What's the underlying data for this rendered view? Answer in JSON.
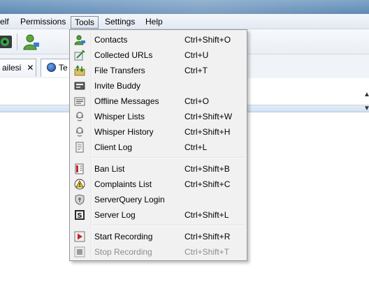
{
  "menubar": {
    "items": [
      {
        "label": "elf"
      },
      {
        "label": "Permissions"
      },
      {
        "label": "Tools"
      },
      {
        "label": "Settings"
      },
      {
        "label": "Help"
      }
    ]
  },
  "tabs": [
    {
      "label": "ailesi",
      "close": "✕"
    },
    {
      "label": "Te"
    }
  ],
  "tools_menu": {
    "groups": [
      [
        {
          "label": "Contacts",
          "shortcut": "Ctrl+Shift+O",
          "icon": "contacts-icon"
        },
        {
          "label": "Collected URLs",
          "shortcut": "Ctrl+U",
          "icon": "collected-urls-icon"
        },
        {
          "label": "File Transfers",
          "shortcut": "Ctrl+T",
          "icon": "file-transfers-icon"
        },
        {
          "label": "Invite Buddy",
          "shortcut": "",
          "icon": "invite-buddy-icon"
        },
        {
          "label": "Offline Messages",
          "shortcut": "Ctrl+O",
          "icon": "offline-messages-icon"
        },
        {
          "label": "Whisper Lists",
          "shortcut": "Ctrl+Shift+W",
          "icon": "whisper-lists-icon"
        },
        {
          "label": "Whisper History",
          "shortcut": "Ctrl+Shift+H",
          "icon": "whisper-history-icon"
        },
        {
          "label": "Client Log",
          "shortcut": "Ctrl+L",
          "icon": "client-log-icon"
        }
      ],
      [
        {
          "label": "Ban List",
          "shortcut": "Ctrl+Shift+B",
          "icon": "ban-list-icon"
        },
        {
          "label": "Complaints List",
          "shortcut": "Ctrl+Shift+C",
          "icon": "complaints-list-icon"
        },
        {
          "label": "ServerQuery Login",
          "shortcut": "",
          "icon": "serverquery-login-icon"
        },
        {
          "label": "Server Log",
          "shortcut": "Ctrl+Shift+L",
          "icon": "server-log-icon"
        }
      ],
      [
        {
          "label": "Start Recording",
          "shortcut": "Ctrl+Shift+R",
          "icon": "start-recording-icon"
        },
        {
          "label": "Stop Recording",
          "shortcut": "Ctrl+Shift+T",
          "icon": "stop-recording-icon",
          "disabled": true
        }
      ]
    ]
  },
  "colors": {
    "menu_bg": "#f1f1f1",
    "menu_border": "#979797",
    "title_bar": "#6f97c0",
    "record_red": "#cc2020"
  }
}
